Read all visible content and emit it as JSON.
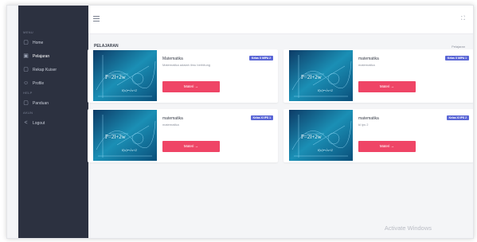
{
  "sidebar": {
    "groups": [
      {
        "label": "MENU",
        "items": [
          {
            "label": "Home",
            "icon": "dashboard-icon"
          },
          {
            "label": "Pelajaran",
            "icon": "book-icon",
            "active": true
          },
          {
            "label": "Rekap Kuiser",
            "icon": "list-icon"
          },
          {
            "label": "Profile",
            "icon": "user-icon"
          }
        ]
      },
      {
        "label": "HELP",
        "items": [
          {
            "label": "Panduan",
            "icon": "file-icon"
          }
        ]
      },
      {
        "label": "AKUN",
        "items": [
          {
            "label": "Logout",
            "icon": "share-icon"
          }
        ]
      }
    ]
  },
  "header": {
    "menu_icon": "hamburger-icon",
    "fullscreen_icon": "fullscreen-icon"
  },
  "page": {
    "title": "PELAJARAN",
    "breadcrumb": "Pelajaran"
  },
  "cards": [
    {
      "title": "Matematika",
      "desc": "Matematika adalah ilmu berhitung",
      "badge": "Kelas X MIPA 2",
      "button": "Materi"
    },
    {
      "title": "matematika",
      "desc": "matematika",
      "badge": "Kelas X MIPA 1",
      "button": "Materi"
    },
    {
      "title": "matematika",
      "desc": "matematika",
      "badge": "Kelas XI IPS 1",
      "button": "Materi"
    },
    {
      "title": "matematika",
      "desc": "kl ips 2",
      "badge": "Kelas XI IPS 2",
      "button": "Materi"
    }
  ],
  "button_arrow": "→",
  "watermark": "Activate Windows",
  "colors": {
    "accent_button": "#ef4566",
    "badge": "#5a66d6",
    "sidebar": "#2c3140"
  }
}
